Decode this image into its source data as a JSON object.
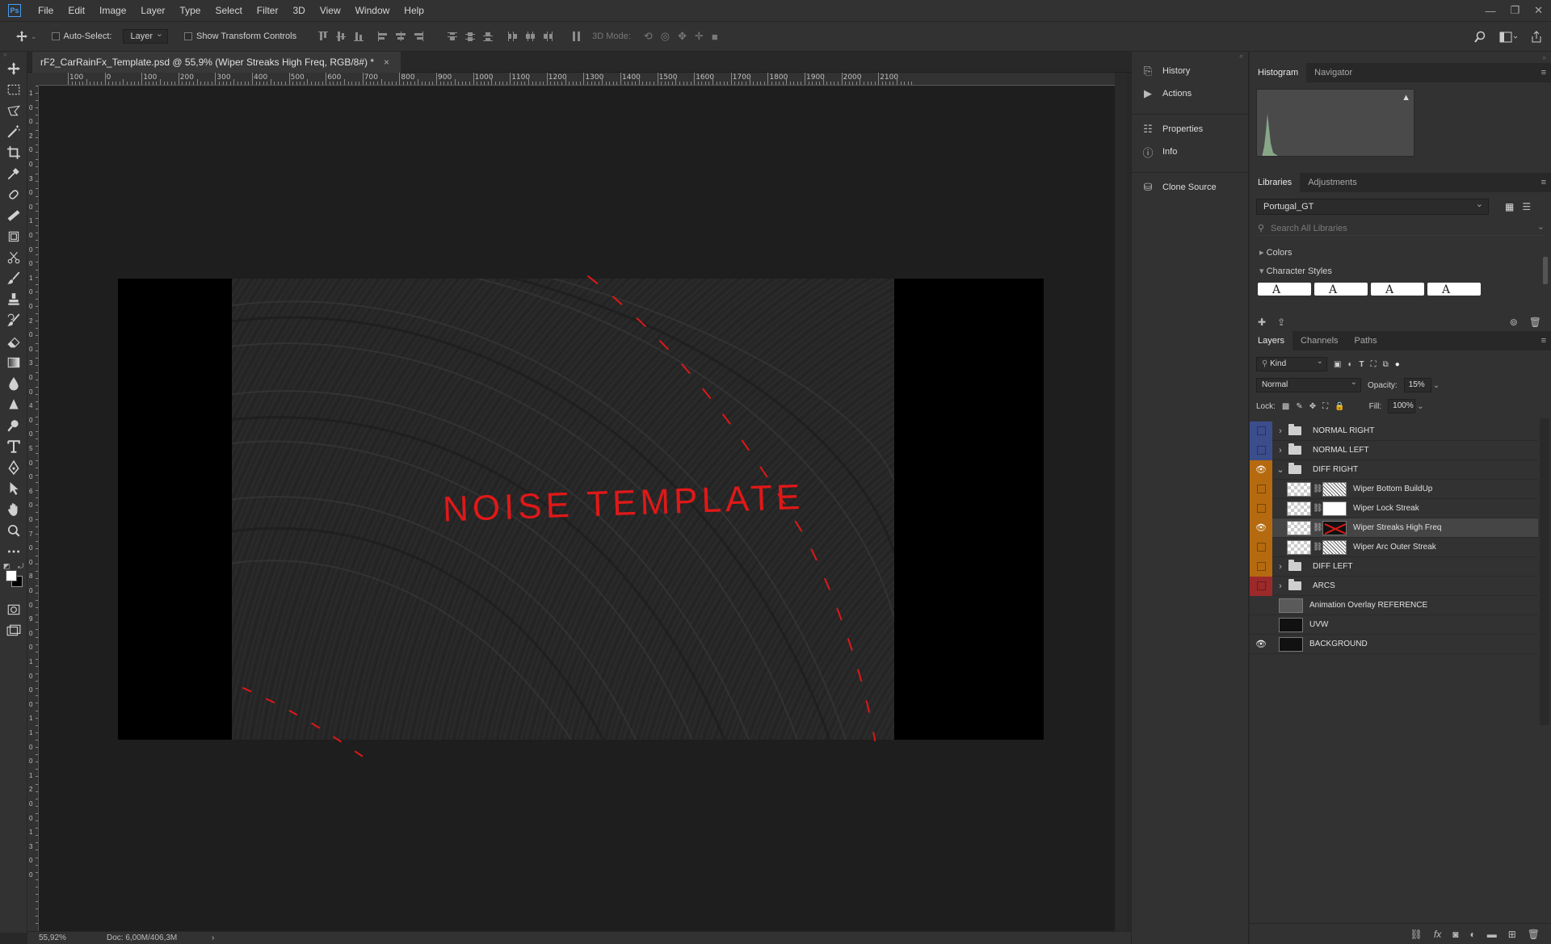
{
  "menubar": {
    "logo": "Ps",
    "items": [
      "File",
      "Edit",
      "Image",
      "Layer",
      "Type",
      "Select",
      "Filter",
      "3D",
      "View",
      "Window",
      "Help"
    ]
  },
  "options": {
    "auto_select_label": "Auto-Select:",
    "auto_select_value": "Layer",
    "show_transform_label": "Show Transform Controls",
    "mode_3d_label": "3D Mode:"
  },
  "document": {
    "tab_title": "rF2_CarRainFx_Template.psd @ 55,9% (Wiper Streaks High Freq, RGB/8#) *",
    "close_glyph": "×",
    "canvas_text": "NOISE TEMPLATE",
    "canvas_text_color": "#e01818"
  },
  "ruler": {
    "h_labels": [
      "100",
      "0",
      "100",
      "200",
      "300",
      "400",
      "500",
      "600",
      "700",
      "800",
      "900",
      "1000",
      "1100",
      "1200",
      "1300",
      "1400",
      "1500",
      "1600",
      "1700",
      "1800",
      "1900",
      "2000",
      "2100"
    ],
    "v_labels": [
      "1",
      "0",
      "0",
      "2",
      "0",
      "0",
      "3",
      "0",
      "0",
      "1",
      "0",
      "0",
      "0",
      "1",
      "0",
      "0",
      "2",
      "0",
      "0",
      "3",
      "0",
      "0",
      "4",
      "0",
      "0",
      "5",
      "0",
      "0",
      "6",
      "0",
      "0",
      "7",
      "0",
      "0",
      "8",
      "0",
      "0",
      "9",
      "0",
      "0",
      "1",
      "0",
      "0",
      "0",
      "1",
      "1",
      "0",
      "0",
      "1",
      "2",
      "0",
      "0",
      "1",
      "3",
      "0",
      "0"
    ]
  },
  "status": {
    "zoom": "55,92%",
    "doc": "Doc: 6,00M/406,3M",
    "arrow": "›"
  },
  "dock": {
    "items": [
      {
        "icon": "history-icon",
        "label": "History"
      },
      {
        "icon": "actions-icon",
        "label": "Actions"
      },
      {
        "icon": "properties-icon",
        "label": "Properties"
      },
      {
        "icon": "info-icon",
        "label": "Info"
      },
      {
        "icon": "clone-source-icon",
        "label": "Clone Source"
      }
    ]
  },
  "histogram": {
    "tabs": [
      "Histogram",
      "Navigator"
    ],
    "warning_glyph": "▲"
  },
  "libraries": {
    "tabs": [
      "Libraries",
      "Adjustments"
    ],
    "selected_library": "Portugal_GT",
    "search_placeholder": "Search All Libraries",
    "sections": [
      "Colors",
      "Character Styles"
    ],
    "char_style_glyph": "A"
  },
  "layers_panel": {
    "tabs": [
      "Layers",
      "Channels",
      "Paths"
    ],
    "kind_label": "Kind",
    "blend_mode": "Normal",
    "opacity_label": "Opacity:",
    "opacity_value": "15%",
    "lock_label": "Lock:",
    "fill_label": "Fill:",
    "fill_value": "100%",
    "layers": [
      {
        "name": "NORMAL RIGHT",
        "type": "group",
        "color": "#3c4d8c",
        "visible": false,
        "expanded": false,
        "indent": 0
      },
      {
        "name": "NORMAL LEFT",
        "type": "group",
        "color": "#3c4d8c",
        "visible": false,
        "expanded": false,
        "indent": 0
      },
      {
        "name": "DIFF RIGHT",
        "type": "group",
        "color": "#b56a10",
        "visible": true,
        "expanded": true,
        "indent": 0
      },
      {
        "name": "Wiper Bottom BuildUp",
        "type": "masked",
        "color": "#b56a10",
        "visible": false,
        "indent": 1
      },
      {
        "name": "Wiper Lock Streak",
        "type": "masked",
        "color": "#b56a10",
        "visible": false,
        "indent": 1
      },
      {
        "name": "Wiper Streaks High Freq",
        "type": "masked",
        "color": "#b56a10",
        "visible": true,
        "indent": 1,
        "selected": true
      },
      {
        "name": "Wiper Arc Outer Streak",
        "type": "masked",
        "color": "#b56a10",
        "visible": false,
        "indent": 1
      },
      {
        "name": "DIFF LEFT",
        "type": "group",
        "color": "#b56a10",
        "visible": false,
        "expanded": false,
        "indent": 0
      },
      {
        "name": "ARCS",
        "type": "group",
        "color": "#9c2a2a",
        "visible": false,
        "expanded": false,
        "indent": 0
      },
      {
        "name": "Animation Overlay REFERENCE",
        "type": "pixel",
        "color": "",
        "visible": false,
        "indent": 0
      },
      {
        "name": "UVW",
        "type": "pixel",
        "color": "",
        "visible": false,
        "indent": 0
      },
      {
        "name": "BACKGROUND",
        "type": "pixel",
        "color": "",
        "visible": true,
        "indent": 0
      }
    ]
  }
}
